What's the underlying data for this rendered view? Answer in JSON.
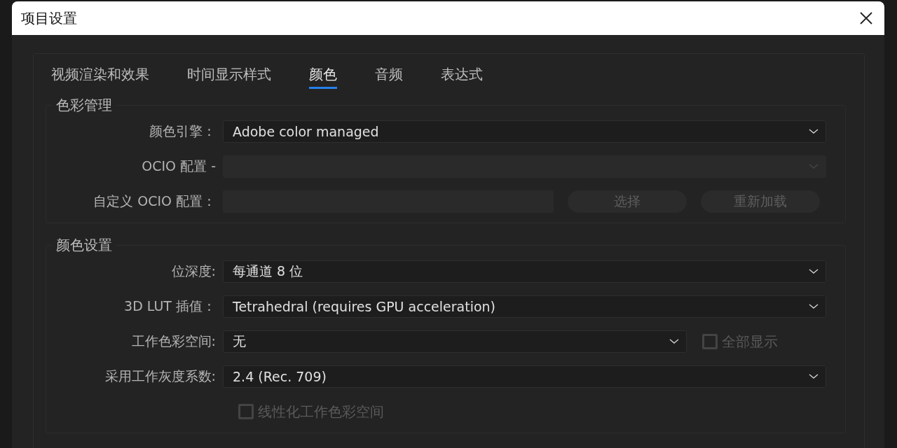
{
  "window": {
    "title": "项目设置"
  },
  "tabs": [
    {
      "label": "视频渲染和效果",
      "selected": false
    },
    {
      "label": "时间显示样式",
      "selected": false
    },
    {
      "label": "颜色",
      "selected": true
    },
    {
      "label": "音频",
      "selected": false
    },
    {
      "label": "表达式",
      "selected": false
    }
  ],
  "groups": [
    {
      "title": "色彩管理",
      "rows": [
        {
          "kind": "select",
          "label": "颜色引擎：",
          "value": "Adobe color managed",
          "disabled": false
        },
        {
          "kind": "select",
          "label": "OCIO 配置 -",
          "disabled": true
        },
        {
          "kind": "input-buttons",
          "label": "自定义 OCIO 配置：",
          "disabled": true,
          "buttons": [
            "选择",
            "重新加载"
          ]
        }
      ]
    },
    {
      "title": "颜色设置",
      "rows": [
        {
          "kind": "select",
          "label": "位深度:",
          "value": "每通道 8 位",
          "disabled": false
        },
        {
          "kind": "select",
          "label": "3D LUT 插值：",
          "value": "Tetrahedral (requires GPU acceleration)",
          "disabled": false
        },
        {
          "kind": "select-checkbox",
          "label": "工作色彩空间:",
          "value": "无",
          "disabled": false,
          "checkbox": {
            "label": "全部显示",
            "checked": false,
            "disabled": true
          }
        },
        {
          "kind": "select",
          "label": "采用工作灰度系数:",
          "value": "2.4 (Rec. 709)",
          "disabled": false
        },
        {
          "kind": "checkbox",
          "checkbox": {
            "label": "线性化工作色彩空间",
            "checked": false,
            "disabled": true
          }
        }
      ]
    }
  ]
}
